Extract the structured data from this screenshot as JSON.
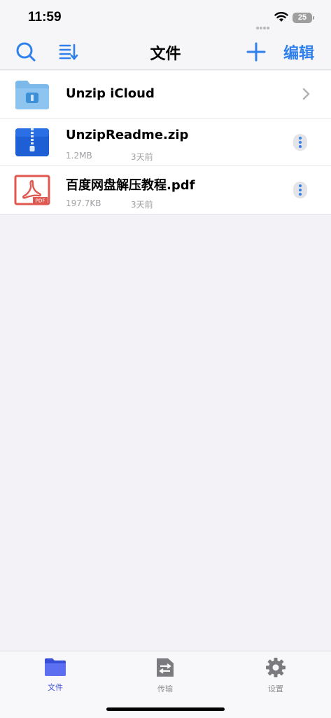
{
  "status": {
    "time": "11:59",
    "battery": "25"
  },
  "nav": {
    "title": "文件",
    "edit_label": "编辑",
    "icons": {
      "left1": "search-icon",
      "left2": "sort-list-icon",
      "right": "plus-icon"
    }
  },
  "files": [
    {
      "name": "Unzip iCloud",
      "kind": "folder",
      "icon": "cloud-folder-icon"
    },
    {
      "name": "UnzipReadme.zip",
      "kind": "zip",
      "size": "1.2MB",
      "date": "3天前",
      "icon": "zip-archive-icon"
    },
    {
      "name": "百度网盘解压教程.pdf",
      "kind": "pdf",
      "size": "197.7KB",
      "date": "3天前",
      "icon": "pdf-file-icon",
      "badge": "PDF"
    }
  ],
  "tabs": [
    {
      "label": "文件",
      "icon": "folder-icon",
      "active": true
    },
    {
      "label": "传输",
      "icon": "transfer-icon",
      "active": false
    },
    {
      "label": "设置",
      "icon": "gear-icon",
      "active": false
    }
  ],
  "colors": {
    "accent": "#2f80ed",
    "tab_active": "#3a4fd8",
    "pdf_red": "#e0584f"
  }
}
